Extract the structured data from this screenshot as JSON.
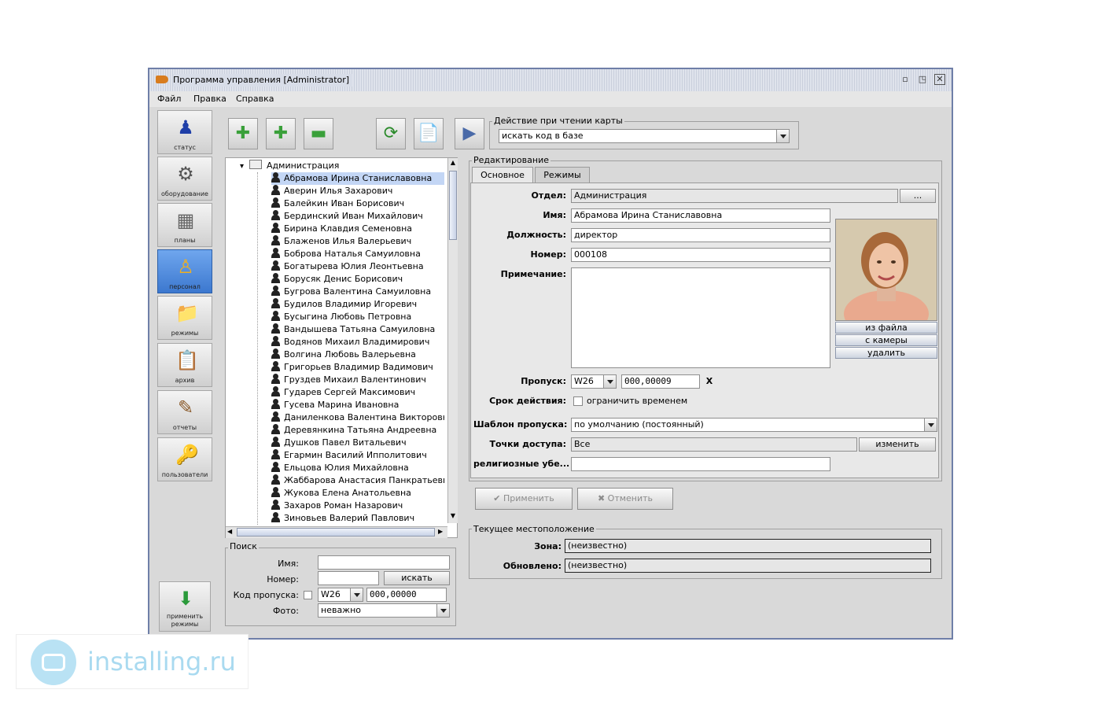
{
  "window": {
    "title": "Программа управления [Administrator]"
  },
  "menu": [
    "Файл",
    "Правка",
    "Справка"
  ],
  "sidebar": {
    "items": [
      {
        "label": "статус",
        "icon": "status-icon"
      },
      {
        "label": "оборудование",
        "icon": "equipment-icon"
      },
      {
        "label": "планы",
        "icon": "plans-icon"
      },
      {
        "label": "персонал",
        "icon": "personnel-icon",
        "active": true
      },
      {
        "label": "режимы",
        "icon": "modes-icon"
      },
      {
        "label": "архив",
        "icon": "archive-icon"
      },
      {
        "label": "отчеты",
        "icon": "reports-icon"
      },
      {
        "label": "пользователи",
        "icon": "users-icon"
      }
    ],
    "apply_label": "применить режимы"
  },
  "card_action": {
    "group_label": "Действие при чтении карты",
    "value": "искать код в базе"
  },
  "tree": {
    "root": "Администрация",
    "people": [
      "Абрамова Ирина Станиславовна",
      "Аверин Илья Захарович",
      "Балейкин Иван Борисович",
      "Бердинский Иван Михайлович",
      "Бирина Клавдия Семеновна",
      "Блаженов Илья Валерьевич",
      "Боброва Наталья Самуиловна",
      "Богатырева Юлия Леонтьевна",
      "Борусяк Денис Борисович",
      "Бугрова Валентина Самуиловна",
      "Будилов Владимир Игоревич",
      "Бусыгина Любовь Петровна",
      "Вандышева Татьяна Самуиловна",
      "Водянов Михаил Владимирович",
      "Волгина Любовь Валерьевна",
      "Григорьев Владимир Вадимович",
      "Груздев Михаил Валентинович",
      "Гударев Сергей Максимович",
      "Гусева Марина Ивановна",
      "Даниленкова Валентина Викторовн",
      "Деревянкина Татьяна Андреевна",
      "Душков Павел Витальевич",
      "Егармин Василий Ипполитович",
      "Ельцова Юлия Михайловна",
      "Жаббарова Анастасия Панкратьевн",
      "Жукова Елена Анатольевна",
      "Захаров Роман Назарович",
      "Зиновьев Валерий Павлович"
    ]
  },
  "search": {
    "group_label": "Поиск",
    "name_label": "Имя:",
    "number_label": "Номер:",
    "search_button": "искать",
    "pass_code_label": "Код пропуска:",
    "pass_type": "W26",
    "pass_code": "000,00000",
    "photo_label": "Фото:",
    "photo_value": "неважно"
  },
  "editing": {
    "group_label": "Редактирование",
    "tabs": [
      "Основное",
      "Режимы"
    ],
    "department_label": "Отдел:",
    "department_value": "Администрация",
    "department_button": "...",
    "name_label": "Имя:",
    "name_value": "Абрамова Ирина Станиславовна",
    "position_label": "Должность:",
    "position_value": "директор",
    "number_label": "Номер:",
    "number_value": "000108",
    "note_label": "Примечание:",
    "photo_buttons": [
      "из файла",
      "с камеры",
      "удалить"
    ],
    "pass_label": "Пропуск:",
    "pass_type": "W26",
    "pass_code": "000,00009",
    "pass_clear": "X",
    "validity_label": "Срок действия:",
    "validity_checkbox": "ограничить временем",
    "template_label": "Шаблон пропуска:",
    "template_value": "по умолчанию (постоянный)",
    "access_label": "Точки доступа:",
    "access_value": "Все",
    "access_button": "изменить",
    "religion_label": "религиозные убе..."
  },
  "actions": {
    "apply": "Применить",
    "cancel": "Отменить"
  },
  "location": {
    "group_label": "Текущее местоположение",
    "zone_label": "Зона:",
    "zone_value": "(неизвестно)",
    "updated_label": "Обновлено:",
    "updated_value": "(неизвестно)"
  },
  "watermark": {
    "text": "installing.ru"
  },
  "colors": {
    "window_border": "#6f7fa8",
    "active_sidebar": "#4f8ae0",
    "selection": "#c3d6f5"
  }
}
